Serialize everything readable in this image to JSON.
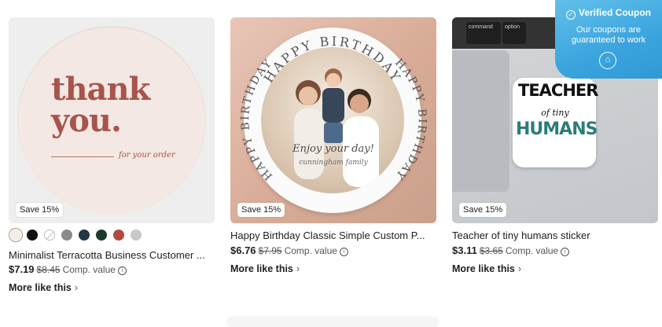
{
  "coupon": {
    "title": "Verified Coupon",
    "body": "Our coupons are guaranteed to work",
    "check_icon": "check-circle-icon",
    "badge_icon": "coupon-tag-icon"
  },
  "products": [
    {
      "save_badge": "Save 15%",
      "title": "Minimalist Terracotta Business Customer ...",
      "price": "$7.19",
      "original_price": "$8.45",
      "comp_value": "Comp. value",
      "more_like_this": "More like this",
      "image_text": {
        "line1": "thank",
        "line2": "you.",
        "line3": "for your order"
      },
      "swatches": [
        "#f6ece6",
        "#111111",
        "none",
        "#8a8a8a",
        "#243546",
        "#1d3b2c",
        "#b34a3e",
        "#c9c9c9"
      ]
    },
    {
      "save_badge": "Save 15%",
      "title": "Happy Birthday Classic Simple Custom P...",
      "price": "$6.76",
      "original_price": "$7.95",
      "comp_value": "Comp. value",
      "more_like_this": "More like this",
      "image_text": {
        "ring": "HAPPY BIRTHDAY",
        "script1": "Enjoy your day!",
        "script2": "cunningham family"
      }
    },
    {
      "save_badge": "Save 15%",
      "title": "Teacher of tiny humans sticker",
      "price": "$3.11",
      "original_price": "$3.65",
      "comp_value": "Comp. value",
      "more_like_this": "More like this",
      "image_text": {
        "top": "TEACHER",
        "mid": "of tiny",
        "bottom": "HUMANS",
        "key1": "command",
        "key2": "option"
      }
    }
  ]
}
